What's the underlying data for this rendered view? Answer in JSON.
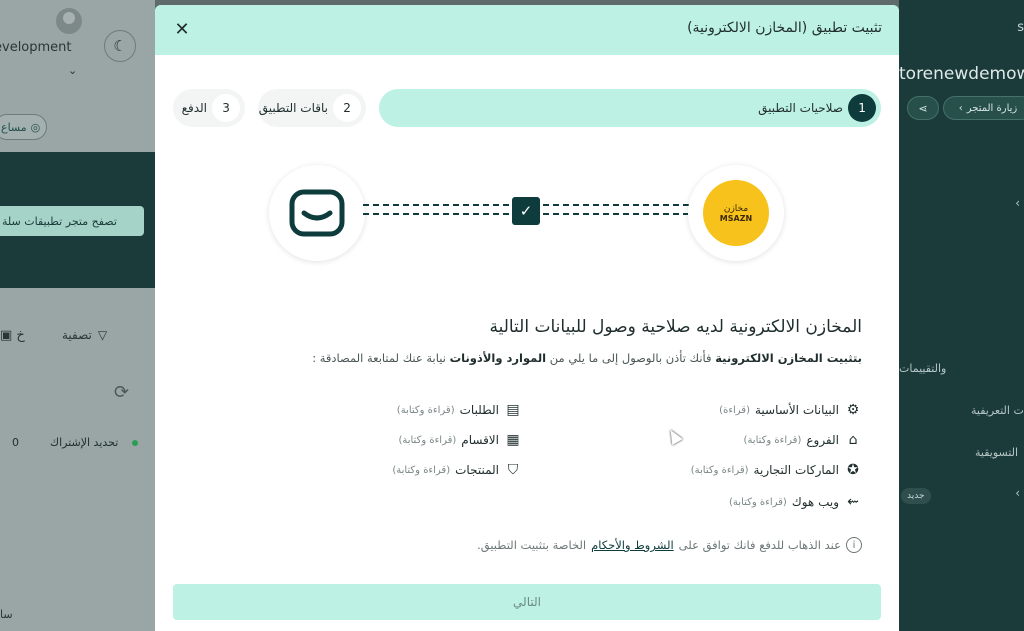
{
  "background": {
    "left": {
      "dev_label": "evelopment",
      "help_label": "مساع",
      "banner_button": "تصفح متجر تطبيقات سلة",
      "filter_label": "تصفية",
      "bag_label": "خ",
      "row_text": "تحديد الإشتراك",
      "row_value": "0",
      "bottom_text": "سا"
    },
    "right": {
      "logo_fragment": "s",
      "store_name": "torenewdemow",
      "visit_store": "زيارة المتجر",
      "menu_1": "والتقييمات",
      "menu_2": "ت التعريفية",
      "menu_3": "التسويقية",
      "new_badge": "جديد"
    }
  },
  "modal": {
    "title": "تثبيت تطبيق (المخازن الالكترونية)",
    "steps": [
      {
        "num": "1",
        "label": "صلاحيات التطبيق",
        "active": true
      },
      {
        "num": "2",
        "label": "باقات التطبيق",
        "active": false
      },
      {
        "num": "3",
        "label": "الدفع",
        "active": false
      }
    ],
    "app_logo": {
      "ar": "مخازن",
      "en": "MSAZN"
    },
    "permissions_title": "المخازن الالكترونية لديه صلاحية وصول للبيانات التالية",
    "permissions_desc": {
      "part1": "بتثبيت المخازن الالكترونية",
      "part2": "فأنك تأذن بالوصول إلى ما يلي من",
      "part3": "الموارد والأذونات",
      "part4": "نيابة عنك لمتابعة المصادقة :"
    },
    "permissions": [
      {
        "label": "البيانات الأساسية",
        "access": "(قراءة)",
        "icon": "gear-icon"
      },
      {
        "label": "الطلبات",
        "access": "(قراءة وكتابة)",
        "icon": "box-icon"
      },
      {
        "label": "الفروع",
        "access": "(قراءة وكتابة)",
        "icon": "store-icon"
      },
      {
        "label": "الاقسام",
        "access": "(قراءة وكتابة)",
        "icon": "inbox-icon"
      },
      {
        "label": "الماركات التجارية",
        "access": "(قراءة وكتابة)",
        "icon": "award-icon"
      },
      {
        "label": "المنتجات",
        "access": "(قراءة وكتابة)",
        "icon": "shirt-icon"
      },
      {
        "label": "ويب هوك",
        "access": "(قراءة وكتابة)",
        "icon": "webhook-icon"
      }
    ],
    "terms": {
      "part1": "عند الذهاب للدفع فانك توافق على",
      "link": "الشروط والأحكام",
      "part2": "الخاصة بتثبيت التطبيق."
    },
    "next_button": "التالي"
  }
}
